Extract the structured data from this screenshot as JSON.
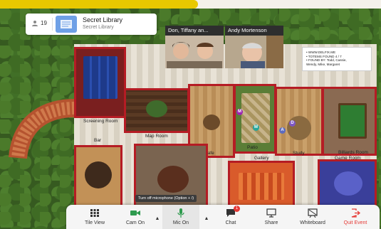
{
  "header": {
    "participant_count": "19",
    "space_name": "Secret Library",
    "space_subtitle": "Secret Library"
  },
  "video_tiles": [
    {
      "name": "Don, Tiffany an..."
    },
    {
      "name": "Andy Mortenson"
    }
  ],
  "notice_board": {
    "lines": [
      "• WWW.DELFIX.ME",
      "• TOTEMS FOUND 4 / 7",
      "• FOUND BY: Todd, Cassie,",
      "  Wendy, Mike, Margaret"
    ]
  },
  "rooms": {
    "screening_room": "Screening Room",
    "map_room": "Map Room",
    "bar": "Bar",
    "cafe": "Cafe",
    "patio": "Patio",
    "gallery": "Gallery",
    "study": "Study",
    "billiards_room": "Billiards Room",
    "game_room": "Game Room"
  },
  "avatars": [
    {
      "letter": "M",
      "color": "#9c27b0"
    },
    {
      "letter": "M",
      "color": "#26a69a"
    },
    {
      "letter": "D",
      "color": "#7e57c2"
    },
    {
      "letter": "A",
      "color": "#5c6bc0"
    }
  ],
  "tooltip": "Turn off microphone (Option + /)",
  "toolbar": {
    "tile_view": "Tile View",
    "cam_on": "Cam On",
    "mic_on": "Mic On",
    "chat": "Chat",
    "chat_badge": "1",
    "share": "Share",
    "whiteboard": "Whiteboard",
    "quit_event": "Quit Event"
  },
  "colors": {
    "progress": "#e8c800",
    "cam_green": "#2e9b4e",
    "mic_green": "#2e9b4e",
    "quit_red": "#e53935",
    "wall_red": "#b51c24"
  },
  "progress": 0.52
}
